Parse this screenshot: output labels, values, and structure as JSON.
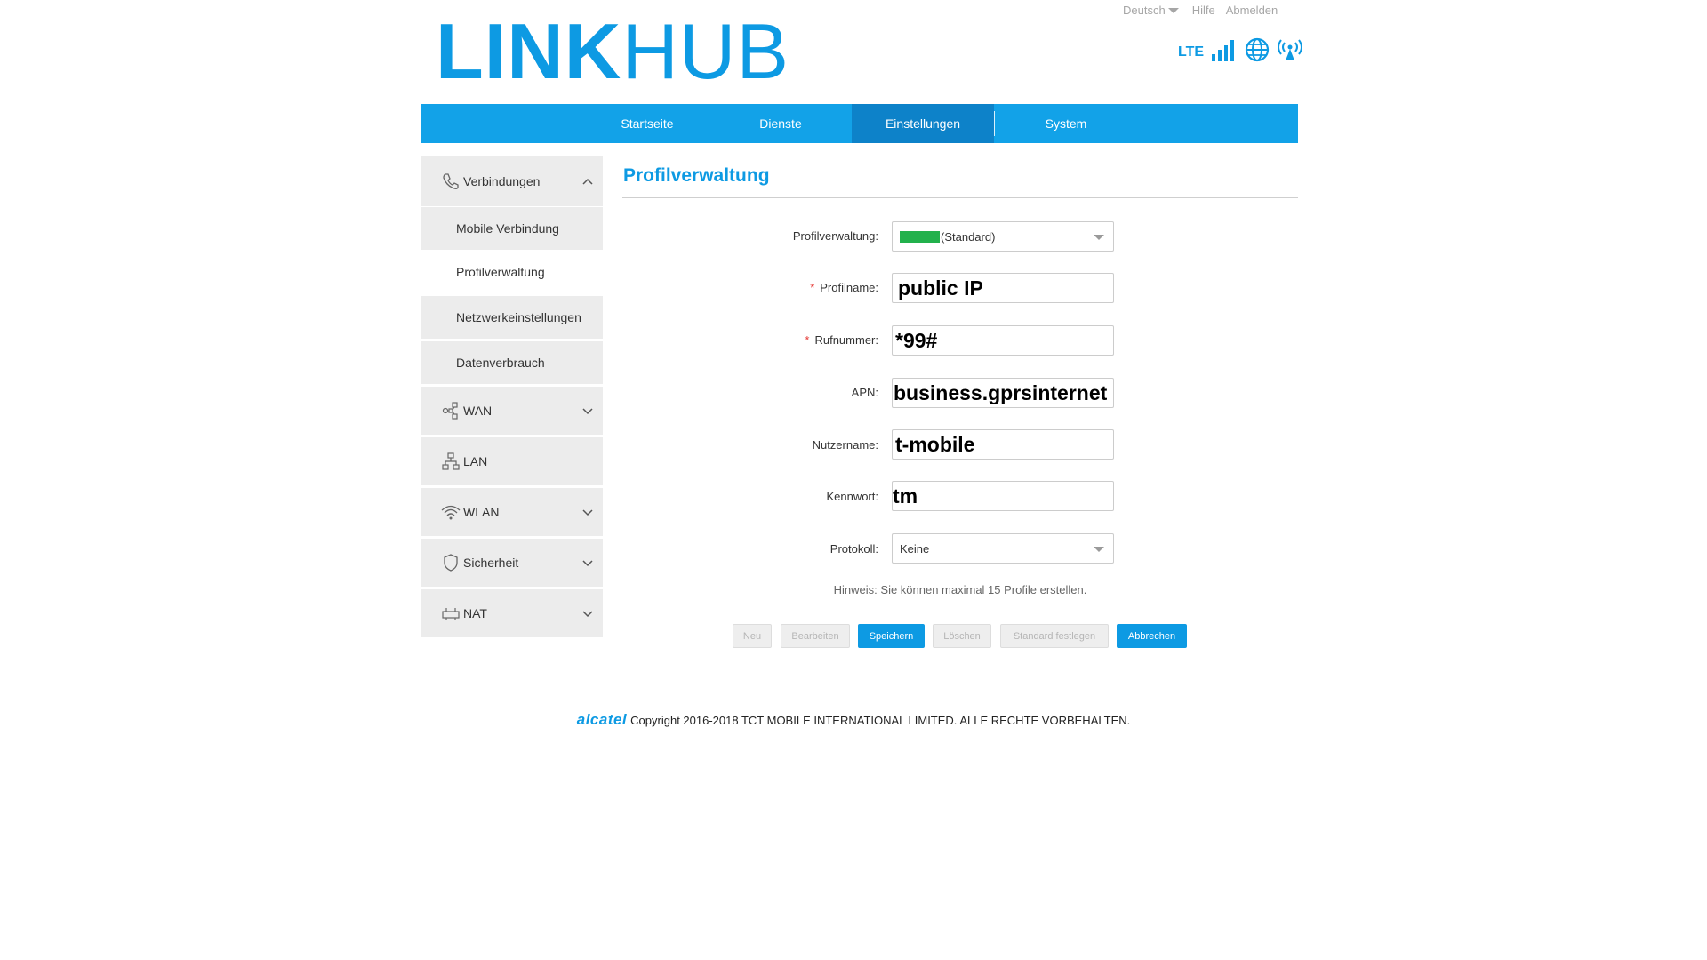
{
  "top_links": {
    "language": "Deutsch",
    "help": "Hilfe",
    "logout": "Abmelden"
  },
  "logo": {
    "part1": "LINK",
    "part2": "HUB"
  },
  "status": {
    "network_type": "LTE",
    "icons": [
      "signal-bars-icon",
      "globe-icon",
      "wifi-broadcast-icon"
    ]
  },
  "nav": {
    "items": [
      "Startseite",
      "Dienste",
      "Einstellungen",
      "System"
    ],
    "active": "Einstellungen"
  },
  "sidebar": {
    "connections": "Verbindungen",
    "sub_items": [
      "Mobile Verbindung",
      "Profilverwaltung",
      "Netzwerkeinstellungen",
      "Datenverbrauch"
    ],
    "active_sub": "Profilverwaltung",
    "sections": [
      "WAN",
      "LAN",
      "WLAN",
      "Sicherheit",
      "NAT"
    ]
  },
  "page": {
    "title": "Profilverwaltung"
  },
  "form": {
    "profile_select_label": "Profilverwaltung:",
    "profile_select_value": "(Standard)",
    "profile_name_label": "Profilname:",
    "profile_name_value": "public IP",
    "dial_number_label": "Rufnummer:",
    "dial_number_value": "*99#",
    "apn_label": "APN:",
    "apn_value": "business.gprsinternet",
    "username_label": "Nutzername:",
    "username_value": "t-mobile",
    "password_label": "Kennwort:",
    "password_value": "tm",
    "protocol_label": "Protokoll:",
    "protocol_value": "Keine",
    "required_marker": "*"
  },
  "hint": "Hinweis: Sie können maximal 15 Profile erstellen.",
  "buttons": {
    "new": "Neu",
    "edit": "Bearbeiten",
    "save": "Speichern",
    "delete": "Löschen",
    "set_default": "Standard festlegen",
    "cancel": "Abbrechen"
  },
  "footer": {
    "brand": "alcatel",
    "copyright": "Copyright 2016-2018 TCT MOBILE INTERNATIONAL LIMITED. ALLE RECHTE VORBEHALTEN."
  },
  "colors": {
    "accent": "#0d9ae3",
    "nav_bg": "#12a2e8",
    "nav_active": "#0d82c9",
    "required": "#e53935",
    "profile_swatch": "#22b14c"
  }
}
